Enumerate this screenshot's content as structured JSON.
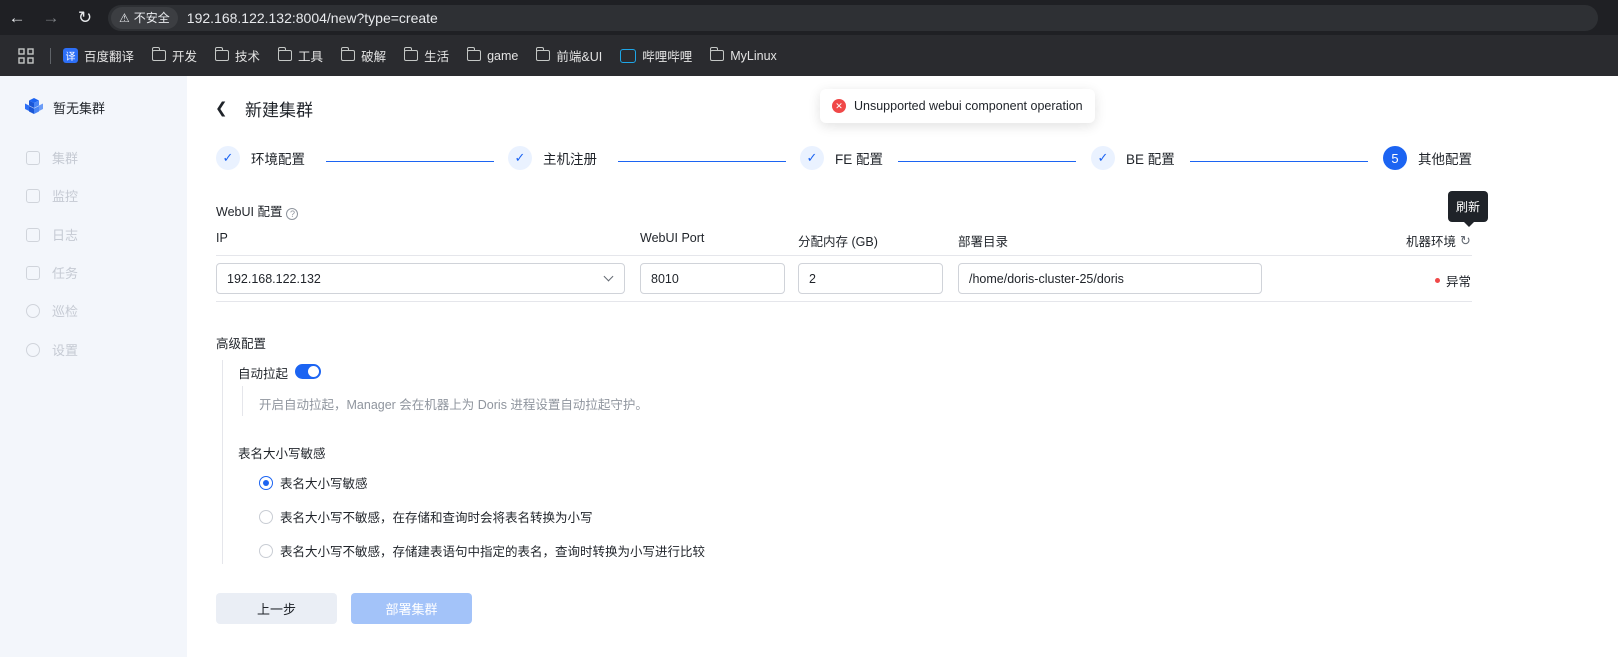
{
  "browser": {
    "security_label": "不安全",
    "url": "192.168.122.132:8004/new?type=create",
    "bookmarks": [
      {
        "label": "百度翻译",
        "icon": "fanyi-icon"
      },
      {
        "label": "开发",
        "icon": "folder-icon"
      },
      {
        "label": "技术",
        "icon": "folder-icon"
      },
      {
        "label": "工具",
        "icon": "folder-icon"
      },
      {
        "label": "破解",
        "icon": "folder-icon"
      },
      {
        "label": "生活",
        "icon": "folder-icon"
      },
      {
        "label": "game",
        "icon": "folder-icon"
      },
      {
        "label": "前端&UI",
        "icon": "folder-icon"
      },
      {
        "label": "哔哩哔哩",
        "icon": "bilibili-icon"
      },
      {
        "label": "MyLinux",
        "icon": "folder-icon"
      }
    ]
  },
  "sidebar": {
    "brand": "暂无集群",
    "items": [
      {
        "label": "集群",
        "icon": "cluster-icon"
      },
      {
        "label": "监控",
        "icon": "monitor-icon"
      },
      {
        "label": "日志",
        "icon": "log-icon"
      },
      {
        "label": "任务",
        "icon": "task-icon"
      },
      {
        "label": "巡检",
        "icon": "inspect-icon"
      },
      {
        "label": "设置",
        "icon": "settings-icon"
      }
    ]
  },
  "page": {
    "title": "新建集群",
    "toast": "Unsupported webui component operation"
  },
  "steps": [
    {
      "label": "环境配置",
      "state": "done"
    },
    {
      "label": "主机注册",
      "state": "done"
    },
    {
      "label": "FE 配置",
      "state": "done"
    },
    {
      "label": "BE 配置",
      "state": "done"
    },
    {
      "label": "其他配置",
      "state": "active",
      "number": "5"
    }
  ],
  "webui": {
    "section_title": "WebUI 配置",
    "help": "?",
    "headers": {
      "ip": "IP",
      "port": "WebUI Port",
      "memory": "分配内存 (GB)",
      "dir": "部署目录",
      "env": "机器环境"
    },
    "row": {
      "ip": "192.168.122.132",
      "port": "8010",
      "memory": "2",
      "dir": "/home/doris-cluster-25/doris",
      "env_status": "异常"
    },
    "refresh_tooltip": "刷新"
  },
  "advanced": {
    "title": "高级配置",
    "auto_start_label": "自动拉起",
    "auto_start_on": true,
    "auto_start_hint": "开启自动拉起，Manager 会在机器上为 Doris 进程设置自动拉起守护。",
    "case_title": "表名大小写敏感",
    "case_options": [
      "表名大小写敏感",
      "表名大小写不敏感，在存储和查询时会将表名转换为小写",
      "表名大小写不敏感，存储建表语句中指定的表名，查询时转换为小写进行比较"
    ],
    "case_selected": 0
  },
  "actions": {
    "prev": "上一步",
    "deploy": "部署集群"
  },
  "colors": {
    "accent": "#1c64f2",
    "error": "#f04848"
  }
}
